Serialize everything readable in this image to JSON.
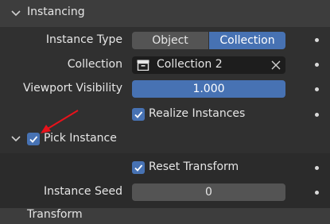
{
  "panel": {
    "title": "Instancing"
  },
  "instance_type": {
    "label": "Instance Type",
    "options": [
      "Object",
      "Collection"
    ],
    "selected": "Collection"
  },
  "collection": {
    "label": "Collection",
    "value": "Collection 2"
  },
  "viewport_visibility": {
    "label": "Viewport Visibility",
    "value": "1.000"
  },
  "realize_instances": {
    "label": "Realize Instances",
    "checked": true
  },
  "pick_instance": {
    "label": "Pick Instance",
    "checked": true
  },
  "reset_transform": {
    "label": "Reset Transform",
    "checked": true
  },
  "instance_seed": {
    "label": "Instance Seed",
    "value": "0"
  },
  "next_panel": {
    "title": "Transform"
  },
  "colors": {
    "accent": "#4772b3",
    "annotation_arrow": "#e8121b"
  }
}
